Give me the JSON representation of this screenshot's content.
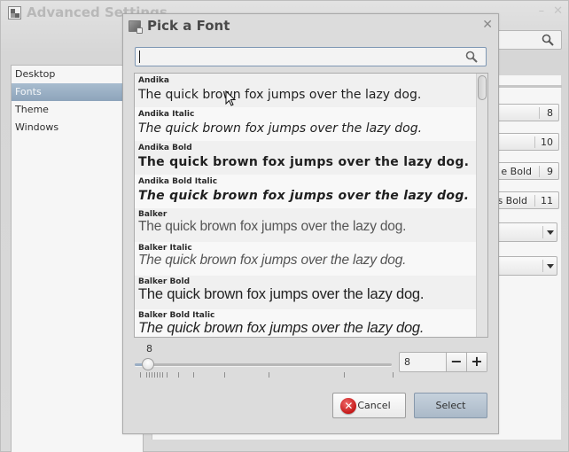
{
  "background_window": {
    "title": "Advanced Settings",
    "minimize_icon": "minimize-icon",
    "close_icon": "close-icon",
    "search_icon": "search-icon",
    "sidebar": {
      "items": [
        {
          "label": "Desktop",
          "selected": false
        },
        {
          "label": "Fonts",
          "selected": true
        },
        {
          "label": "Theme",
          "selected": false
        },
        {
          "label": "Windows",
          "selected": false
        }
      ]
    },
    "font_buttons": [
      {
        "name": "",
        "size": "8"
      },
      {
        "name": "",
        "size": "10"
      },
      {
        "name": "e Bold",
        "size": "9"
      },
      {
        "name": "ns Bold",
        "size": "11"
      }
    ],
    "combos": [
      "",
      ""
    ]
  },
  "dialog": {
    "title": "Pick a Font",
    "close_icon": "close-icon",
    "search": {
      "value": "",
      "placeholder": ""
    },
    "fonts": [
      {
        "name": "Andika",
        "sample": "The quick brown fox jumps over the lazy dog."
      },
      {
        "name": "Andika Italic",
        "sample": "The quick brown fox jumps over the lazy dog."
      },
      {
        "name": "Andika Bold",
        "sample": "The quick brown fox jumps over the lazy dog."
      },
      {
        "name": "Andika Bold Italic",
        "sample": "The quick brown fox jumps over the lazy dog."
      },
      {
        "name": "Balker",
        "sample": "The quick brown fox jumps over the lazy dog."
      },
      {
        "name": "Balker Italic",
        "sample": "The quick brown fox jumps over the lazy dog."
      },
      {
        "name": "Balker Bold",
        "sample": "The quick brown fox jumps over the lazy dog."
      },
      {
        "name": "Balker Bold Italic",
        "sample": "The quick brown fox jumps over the lazy dog."
      }
    ],
    "size": {
      "label": "8",
      "value": "8",
      "slider_fraction": 0.05,
      "decrement_label": "−",
      "increment_label": "+"
    },
    "buttons": {
      "cancel_label": "Cancel",
      "select_label": "Select"
    }
  },
  "colors": {
    "selection": "#8da4bb",
    "select_button": "#aab9c8",
    "cancel_icon": "#c41818"
  }
}
